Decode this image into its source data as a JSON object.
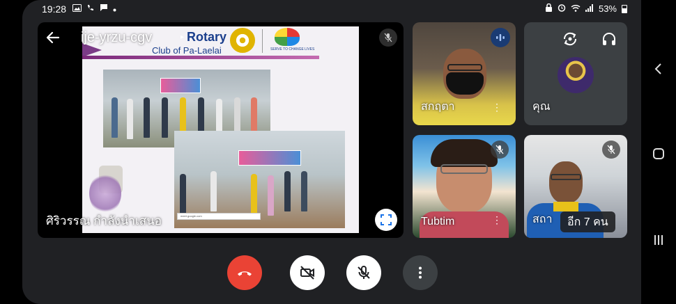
{
  "status_bar": {
    "time": "19:28",
    "battery": "53%",
    "left_icons": [
      "gallery-icon",
      "wifi-call-icon",
      "message-icon",
      "dot-icon"
    ],
    "right_icons": [
      "lock-icon",
      "alarm-icon",
      "wifi-icon",
      "signal-icon",
      "battery-icon"
    ]
  },
  "main": {
    "meeting_code": "ije-yrzu-cgv",
    "presenter_name": "ศิริวรรณ กำลังนำเสนอ",
    "slide": {
      "rotary_title": "Rotary",
      "club_name": "Club of Pa-Laelai",
      "serve_text": "SERVE TO CHANGE LIVES"
    }
  },
  "participants": [
    {
      "name": "สกฤตา",
      "muted": false,
      "speaking": true
    },
    {
      "name": "คุณ",
      "muted": false,
      "self": true
    },
    {
      "name": "Tubtim",
      "muted": true
    },
    {
      "name": "สถา",
      "muted": true
    }
  ],
  "more_participants": "อีก 7 คน",
  "controls": [
    "end-call",
    "camera-off",
    "mic-off",
    "more-options"
  ],
  "colors": {
    "end_call": "#ea4335",
    "speaking_badge": "#1a3b73",
    "tile_bg": "#3c4043"
  }
}
